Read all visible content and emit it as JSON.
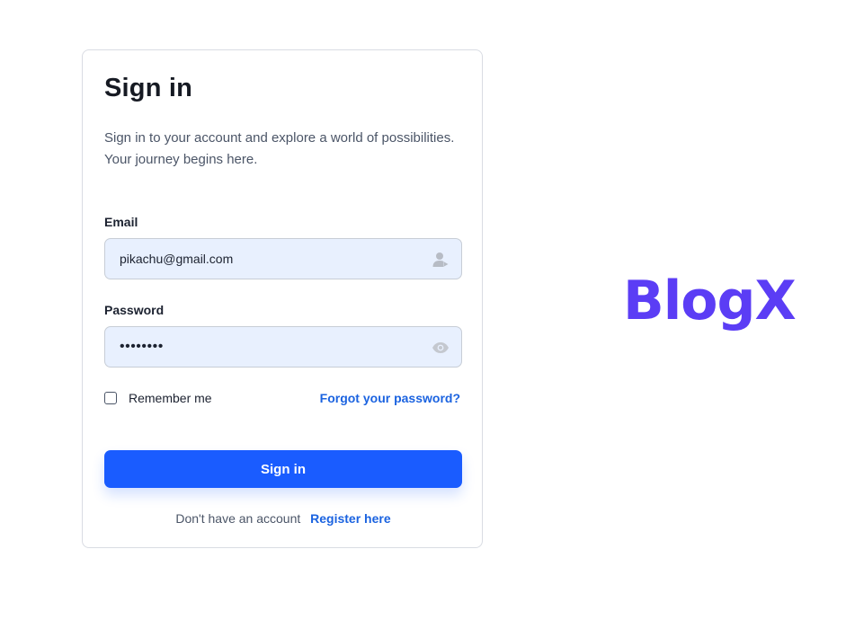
{
  "form": {
    "title": "Sign in",
    "subtitle": "Sign in to your account and explore a world of possibilities. Your journey begins here.",
    "email": {
      "label": "Email",
      "value": "pikachu@gmail.com",
      "icon": "user-icon"
    },
    "password": {
      "label": "Password",
      "value": "••••••••",
      "icon": "eye-icon"
    },
    "remember_label": "Remember me",
    "remember_checked": false,
    "forgot_label": "Forgot your password?",
    "submit_label": "Sign in",
    "register_prompt": "Don't have an account",
    "register_label": "Register here"
  },
  "brand": {
    "name": "BlogX",
    "color": "#5b3df5"
  },
  "colors": {
    "accent": "#1a5cff",
    "link": "#1b63e0",
    "field_bg": "#e8f0fe"
  }
}
